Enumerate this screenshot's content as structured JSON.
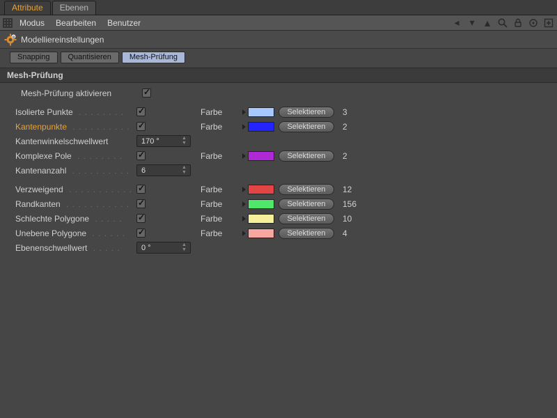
{
  "tabs": {
    "attribute": "Attribute",
    "ebenen": "Ebenen"
  },
  "menu": {
    "modus": "Modus",
    "bearbeiten": "Bearbeiten",
    "benutzer": "Benutzer"
  },
  "title": "Modelliereinstellungen",
  "subtabs": {
    "snapping": "Snapping",
    "quantisieren": "Quantisieren",
    "mesh": "Mesh-Prüfung"
  },
  "section": "Mesh-Prüfung",
  "enable": {
    "label": "Mesh-Prüfung aktivieren",
    "checked": true
  },
  "strings": {
    "farbe": "Farbe",
    "selektieren": "Selektieren"
  },
  "rows": {
    "isoliert": {
      "label": "Isolierte Punkte",
      "checked": true,
      "color": "#a7c7ff",
      "count": "3"
    },
    "kantenpkt": {
      "label": "Kantenpunkte",
      "checked": true,
      "color": "#2424ff",
      "count": "2",
      "accent": true
    },
    "kwinkel": {
      "label": "Kantenwinkelschwellwert",
      "value": "170 °"
    },
    "komppole": {
      "label": "Komplexe Pole",
      "checked": true,
      "color": "#b029d6",
      "count": "2"
    },
    "kanzahl": {
      "label": "Kantenanzahl",
      "value": "6"
    },
    "verzweig": {
      "label": "Verzweigend",
      "checked": true,
      "color": "#e34545",
      "count": "12"
    },
    "randk": {
      "label": "Randkanten",
      "checked": true,
      "color": "#4fe86a",
      "count": "156"
    },
    "schlecht": {
      "label": "Schlechte Polygone",
      "checked": true,
      "color": "#f6ef9b",
      "count": "10"
    },
    "uneben": {
      "label": "Unebene Polygone",
      "checked": true,
      "color": "#f7a7a0",
      "count": "4"
    },
    "eschwell": {
      "label": "Ebenenschwellwert",
      "value": "0 °"
    }
  }
}
